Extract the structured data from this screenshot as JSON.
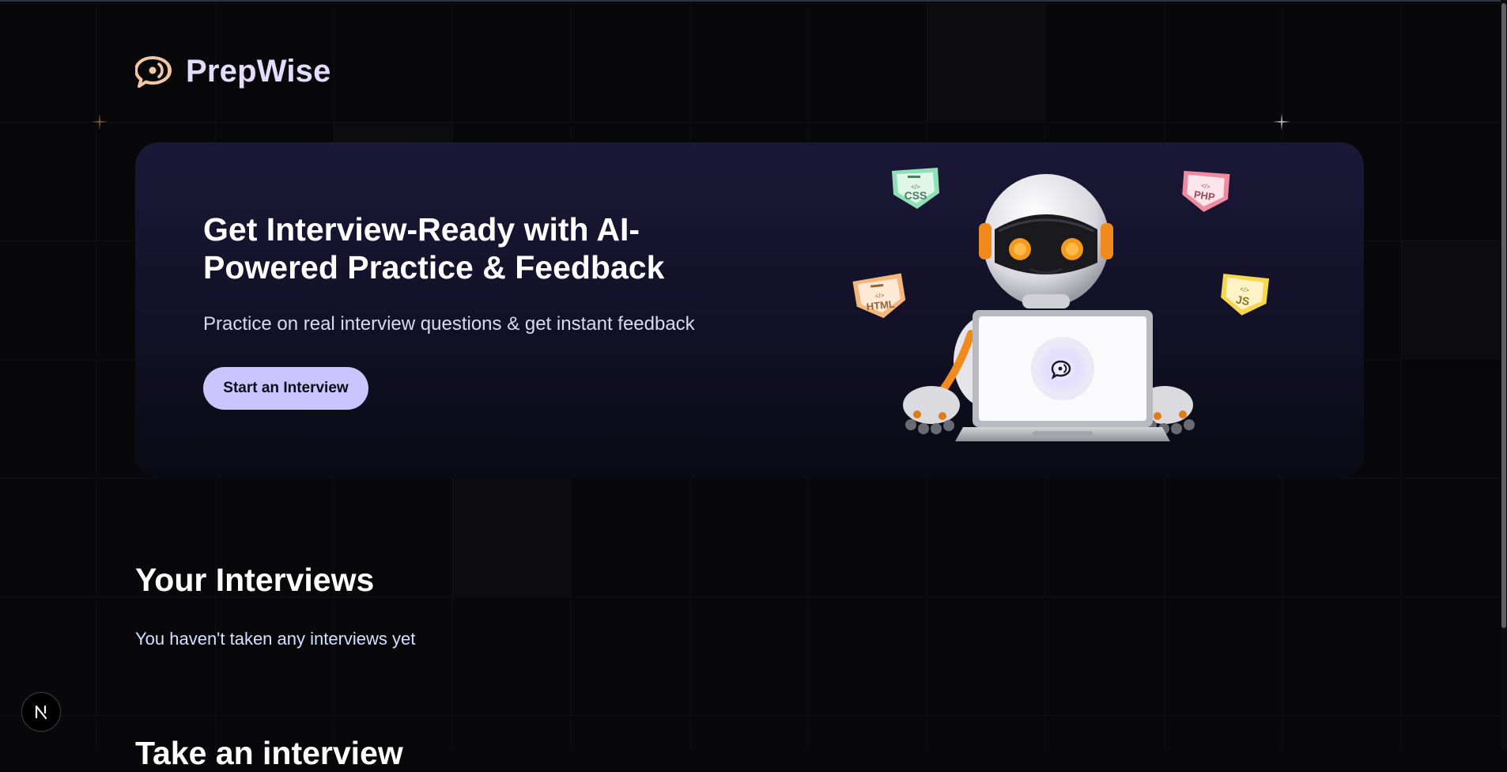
{
  "app": {
    "name": "PrepWise"
  },
  "hero": {
    "title": "Get Interview-Ready with AI-Powered Practice & Feedback",
    "subtitle": "Practice on real interview questions & get instant feedback",
    "cta_label": "Start an Interview",
    "badges": {
      "css": "CSS",
      "php": "PHP",
      "html": "HTML",
      "js": "JS"
    }
  },
  "interviews": {
    "title": "Your Interviews",
    "empty_message": "You haven't taken any interviews yet"
  },
  "take_interview": {
    "title": "Take an interview"
  },
  "devtools": {
    "badge_label": "N"
  },
  "colors": {
    "background": "#08080a",
    "accent": "#cac5fe",
    "logo_text": "#e4dcff",
    "hero_bg": "#1b1838"
  },
  "icons": {
    "logo": "chat-bubble-icon",
    "devtools": "nextjs-icon"
  }
}
